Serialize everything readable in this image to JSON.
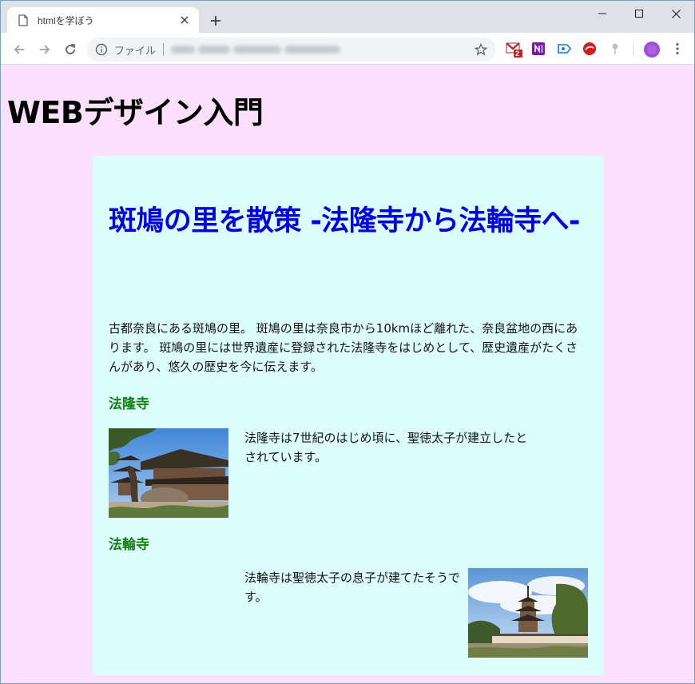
{
  "browser": {
    "tab_title": "htmlを学ぼう",
    "url_scheme_label": "ファイル",
    "notification_badge": "2"
  },
  "page": {
    "site_title": "WEBデザイン入門",
    "article": {
      "title": "斑鳩の里を散策 -法隆寺から法輪寺へ-",
      "intro": "古都奈良にある斑鳩の里。 斑鳩の里は奈良市から10kmほど離れた、奈良盆地の西にあります。 斑鳩の里には世界遺産に登録された法隆寺をはじめとして、歴史遺産がたくさんがあり、悠久の歴史を今に伝えます。",
      "sections": [
        {
          "heading": "法隆寺",
          "text": "法隆寺は7世紀のはじめ頃に、聖徳太子が建立したとされています。",
          "image": "horyuji-temple-photo"
        },
        {
          "heading": "法輪寺",
          "text": "法輪寺は聖徳太子の息子が建てたそうです。",
          "image": "horinji-pagoda-photo"
        }
      ]
    }
  },
  "colors": {
    "page_background": "#fde0fe",
    "article_background": "#dcfffd",
    "article_title": "#0000ee",
    "section_heading": "#108010"
  }
}
